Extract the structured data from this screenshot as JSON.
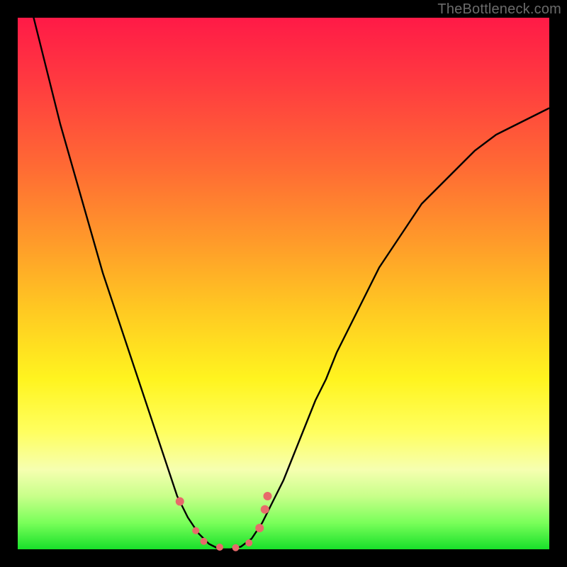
{
  "watermark": "TheBottleneck.com",
  "colors": {
    "frame": "#000000",
    "curve": "#000000",
    "markers": "#e76a6a",
    "gradient_top": "#ff1a47",
    "gradient_bottom": "#18e02a"
  },
  "chart_data": {
    "type": "line",
    "title": "",
    "xlabel": "",
    "ylabel": "",
    "xlim": [
      0,
      100
    ],
    "ylim": [
      0,
      100
    ],
    "x": [
      0,
      2,
      4,
      6,
      8,
      10,
      12,
      14,
      16,
      18,
      20,
      22,
      24,
      26,
      28,
      30,
      32,
      34,
      36,
      38,
      40,
      42,
      44,
      46,
      48,
      50,
      52,
      54,
      56,
      58,
      60,
      62,
      64,
      66,
      68,
      70,
      72,
      74,
      76,
      78,
      80,
      82,
      84,
      86,
      88,
      90,
      92,
      94,
      96,
      98,
      100
    ],
    "series": [
      {
        "name": "bottleneck-curve",
        "values": [
          112,
          104,
          96,
          88,
          80,
          73,
          66,
          59,
          52,
          46,
          40,
          34,
          28,
          22,
          16,
          10,
          6,
          3,
          1,
          0,
          0,
          0.5,
          2,
          5,
          9,
          13,
          18,
          23,
          28,
          32,
          37,
          41,
          45,
          49,
          53,
          56,
          59,
          62,
          65,
          67,
          69,
          71,
          73,
          75,
          76.5,
          78,
          79,
          80,
          81,
          82,
          83
        ]
      }
    ],
    "markers": [
      {
        "x": 30.5,
        "y": 9,
        "r": 6
      },
      {
        "x": 33.5,
        "y": 3.5,
        "r": 5
      },
      {
        "x": 35,
        "y": 1.5,
        "r": 5
      },
      {
        "x": 38,
        "y": 0.4,
        "r": 5
      },
      {
        "x": 41,
        "y": 0.3,
        "r": 5
      },
      {
        "x": 43.5,
        "y": 1.2,
        "r": 5
      },
      {
        "x": 45.5,
        "y": 4,
        "r": 6
      },
      {
        "x": 46.5,
        "y": 7.5,
        "r": 6
      },
      {
        "x": 47,
        "y": 10,
        "r": 6
      }
    ],
    "grid": false,
    "legend": false
  }
}
